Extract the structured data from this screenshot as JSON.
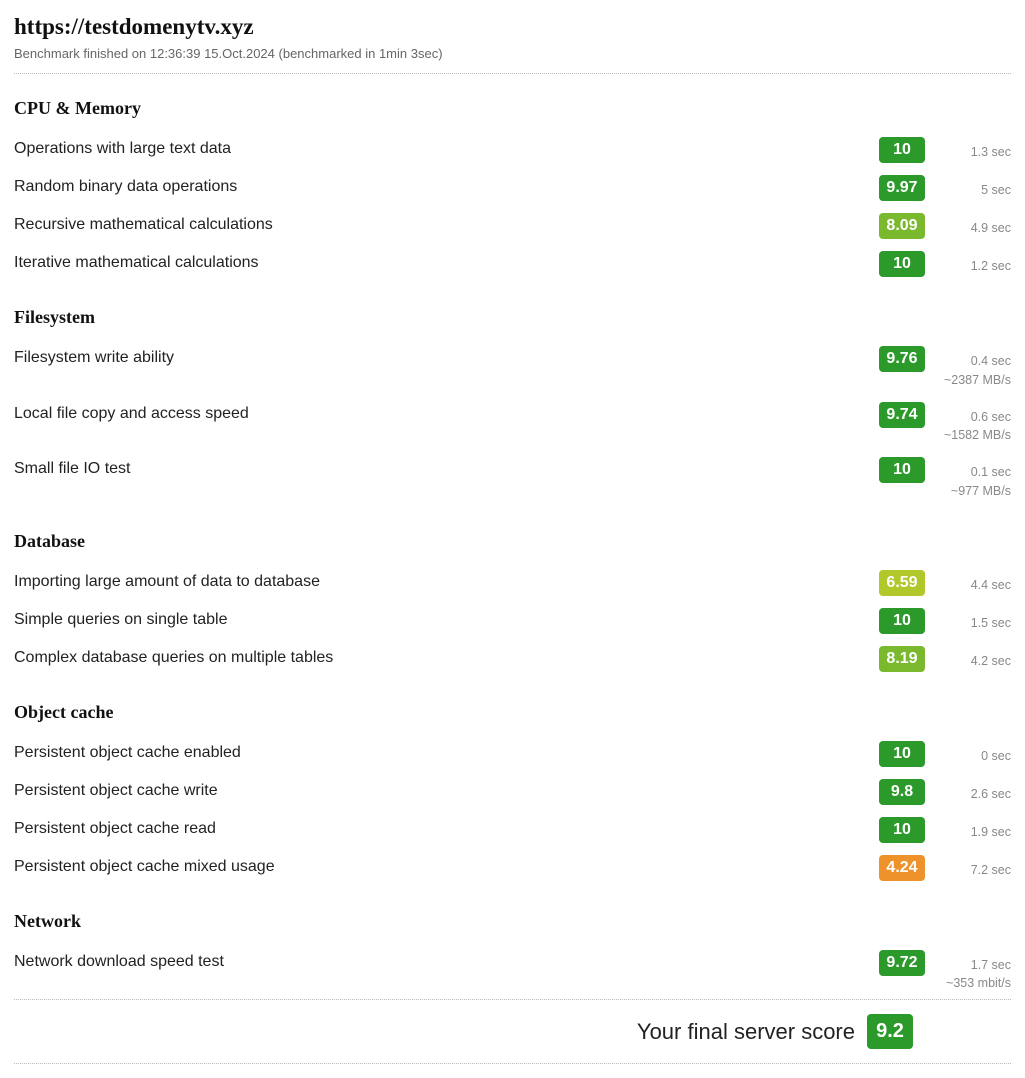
{
  "header": {
    "title": "https://testdomenytv.xyz",
    "subtitle": "Benchmark finished on 12:36:39 15.Oct.2024 (benchmarked in 1min 3sec)"
  },
  "colors": {
    "green": "#2b9a2b",
    "lime": "#7ab82d",
    "yellowgreen": "#b2c72a",
    "orange": "#ee922c"
  },
  "sections": [
    {
      "title": "CPU & Memory",
      "rows": [
        {
          "label": "Operations with large text data",
          "score": "10",
          "color": "green",
          "meta": [
            "1.3 sec"
          ]
        },
        {
          "label": "Random binary data operations",
          "score": "9.97",
          "color": "green",
          "meta": [
            "5 sec"
          ]
        },
        {
          "label": "Recursive mathematical calculations",
          "score": "8.09",
          "color": "lime",
          "meta": [
            "4.9 sec"
          ]
        },
        {
          "label": "Iterative mathematical calculations",
          "score": "10",
          "color": "green",
          "meta": [
            "1.2 sec"
          ]
        }
      ]
    },
    {
      "title": "Filesystem",
      "rows": [
        {
          "label": "Filesystem write ability",
          "score": "9.76",
          "color": "green",
          "meta": [
            "0.4 sec",
            "~2387 MB/s"
          ]
        },
        {
          "label": "Local file copy and access speed",
          "score": "9.74",
          "color": "green",
          "meta": [
            "0.6 sec",
            "~1582 MB/s"
          ]
        },
        {
          "label": "Small file IO test",
          "score": "10",
          "color": "green",
          "meta": [
            "0.1 sec",
            "~977 MB/s"
          ]
        }
      ]
    },
    {
      "title": "Database",
      "rows": [
        {
          "label": "Importing large amount of data to database",
          "score": "6.59",
          "color": "yellowgreen",
          "meta": [
            "4.4 sec"
          ]
        },
        {
          "label": "Simple queries on single table",
          "score": "10",
          "color": "green",
          "meta": [
            "1.5 sec"
          ]
        },
        {
          "label": "Complex database queries on multiple tables",
          "score": "8.19",
          "color": "lime",
          "meta": [
            "4.2 sec"
          ]
        }
      ]
    },
    {
      "title": "Object cache",
      "rows": [
        {
          "label": "Persistent object cache enabled",
          "score": "10",
          "color": "green",
          "meta": [
            "0 sec"
          ]
        },
        {
          "label": "Persistent object cache write",
          "score": "9.8",
          "color": "green",
          "meta": [
            "2.6 sec"
          ]
        },
        {
          "label": "Persistent object cache read",
          "score": "10",
          "color": "green",
          "meta": [
            "1.9 sec"
          ]
        },
        {
          "label": "Persistent object cache mixed usage",
          "score": "4.24",
          "color": "orange",
          "meta": [
            "7.2 sec"
          ]
        }
      ]
    },
    {
      "title": "Network",
      "rows": [
        {
          "label": "Network download speed test",
          "score": "9.72",
          "color": "green",
          "meta": [
            "1.7 sec",
            "~353 mbit/s"
          ]
        }
      ]
    }
  ],
  "final": {
    "label": "Your final server score",
    "score": "9.2",
    "color": "green"
  }
}
